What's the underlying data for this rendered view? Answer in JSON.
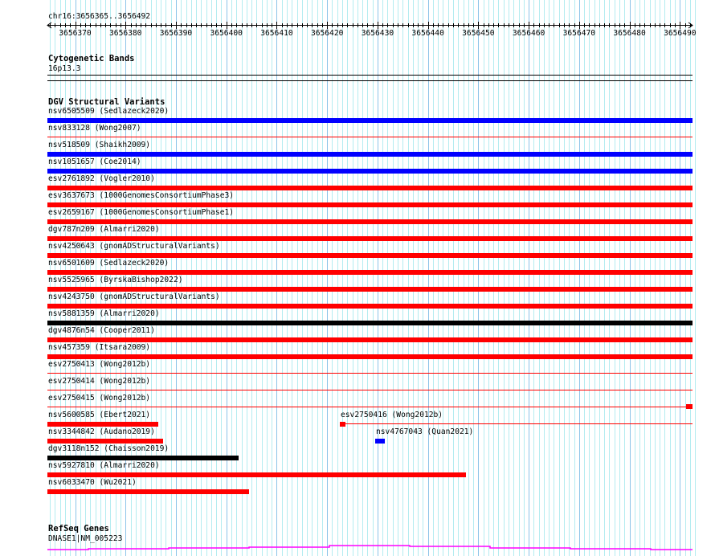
{
  "region": {
    "label": "chr16:3656365..3656492",
    "start": 3656365,
    "end": 3656492
  },
  "ruler": {
    "ticks": [
      "3656370",
      "3656380",
      "3656390",
      "3656400",
      "3656410",
      "3656420",
      "3656430",
      "3656440",
      "3656450",
      "3656460",
      "3656470",
      "3656480",
      "3656490"
    ]
  },
  "cytobands": {
    "title": "Cytogenetic Bands",
    "band": "16p13.3"
  },
  "dgv": {
    "title": "DGV Structural Variants",
    "colors": {
      "blue": "#0000ff",
      "red": "#ff0000",
      "black": "#000000"
    },
    "rows": [
      [
        {
          "label": "nsv6505509 (Sedlazeck2020)",
          "color": "blue",
          "style": "thick",
          "start": 3656365,
          "end": 3656492
        }
      ],
      [
        {
          "label": "nsv833128 (Wong2007)",
          "color": "red",
          "style": "thin",
          "start": 3656365,
          "end": 3656492
        }
      ],
      [
        {
          "label": "nsv518509 (Shaikh2009)",
          "color": "blue",
          "style": "thick",
          "start": 3656365,
          "end": 3656492
        }
      ],
      [
        {
          "label": "nsv1051657 (Coe2014)",
          "color": "blue",
          "style": "thick",
          "start": 3656365,
          "end": 3656492
        }
      ],
      [
        {
          "label": "esv2761892 (Vogler2010)",
          "color": "red",
          "style": "thick",
          "start": 3656365,
          "end": 3656492
        }
      ],
      [
        {
          "label": "esv3637673 (1000GenomesConsortiumPhase3)",
          "color": "red",
          "style": "thick",
          "start": 3656365,
          "end": 3656492
        }
      ],
      [
        {
          "label": "esv2659167 (1000GenomesConsortiumPhase1)",
          "color": "red",
          "style": "thick",
          "start": 3656365,
          "end": 3656492
        }
      ],
      [
        {
          "label": "dgv787n209 (Almarri2020)",
          "color": "red",
          "style": "thick",
          "start": 3656365,
          "end": 3656492
        }
      ],
      [
        {
          "label": "nsv4250643 (gnomADStructuralVariants)",
          "color": "red",
          "style": "thick",
          "start": 3656365,
          "end": 3656492
        }
      ],
      [
        {
          "label": "nsv6501609 (Sedlazeck2020)",
          "color": "red",
          "style": "thick",
          "start": 3656365,
          "end": 3656492
        }
      ],
      [
        {
          "label": "nsv5525965 (ByrskaBishop2022)",
          "color": "red",
          "style": "thick",
          "start": 3656365,
          "end": 3656492
        }
      ],
      [
        {
          "label": "nsv4243750 (gnomADStructuralVariants)",
          "color": "red",
          "style": "thick",
          "start": 3656365,
          "end": 3656492
        }
      ],
      [
        {
          "label": "nsv5881359 (Almarri2020)",
          "color": "black",
          "style": "thick",
          "start": 3656365,
          "end": 3656492
        }
      ],
      [
        {
          "label": "dgv4876n54 (Cooper2011)",
          "color": "red",
          "style": "thick",
          "start": 3656365,
          "end": 3656492
        }
      ],
      [
        {
          "label": "nsv457359 (Itsara2009)",
          "color": "red",
          "style": "thick",
          "start": 3656365,
          "end": 3656492
        }
      ],
      [
        {
          "label": "esv2750413 (Wong2012b)",
          "color": "red",
          "style": "thin",
          "start": 3656365,
          "end": 3656492
        }
      ],
      [
        {
          "label": "esv2750414 (Wong2012b)",
          "color": "red",
          "style": "thin",
          "start": 3656365,
          "end": 3656492
        }
      ],
      [
        {
          "label": "esv2750415 (Wong2012b)",
          "color": "red",
          "style": "thin-block-end",
          "start": 3656365,
          "end": 3656492
        }
      ],
      [
        {
          "label": "nsv5600585 (Ebert2021)",
          "color": "red",
          "style": "thick",
          "start": 3656365,
          "end": 3656386
        },
        {
          "label": "esv2750416 (Wong2012b)",
          "color": "red",
          "style": "thin-block-start",
          "start": 3656423,
          "end": 3656492
        }
      ],
      [
        {
          "label": "nsv3344842 (Audano2019)",
          "color": "red",
          "style": "thick",
          "start": 3656365,
          "end": 3656387
        },
        {
          "label": "nsv4767043 (Quan2021)",
          "color": "blue",
          "style": "thick",
          "start": 3656430,
          "end": 3656431
        }
      ],
      [
        {
          "label": "dgv3118n152 (Chaisson2019)",
          "color": "black",
          "style": "thick",
          "start": 3656365,
          "end": 3656402
        }
      ],
      [
        {
          "label": "nsv5927810 (Almarri2020)",
          "color": "red",
          "style": "thick",
          "start": 3656365,
          "end": 3656447
        }
      ],
      [
        {
          "label": "nsv6033470 (Wu2021)",
          "color": "red",
          "style": "thick",
          "start": 3656365,
          "end": 3656404
        }
      ]
    ]
  },
  "refseq": {
    "title": "RefSeq Genes",
    "gene": "DNASE1|NM_005223",
    "color": "#ff00ff"
  },
  "grid": {
    "minor": "#b4ecf0",
    "major": "#8cc4e8"
  }
}
